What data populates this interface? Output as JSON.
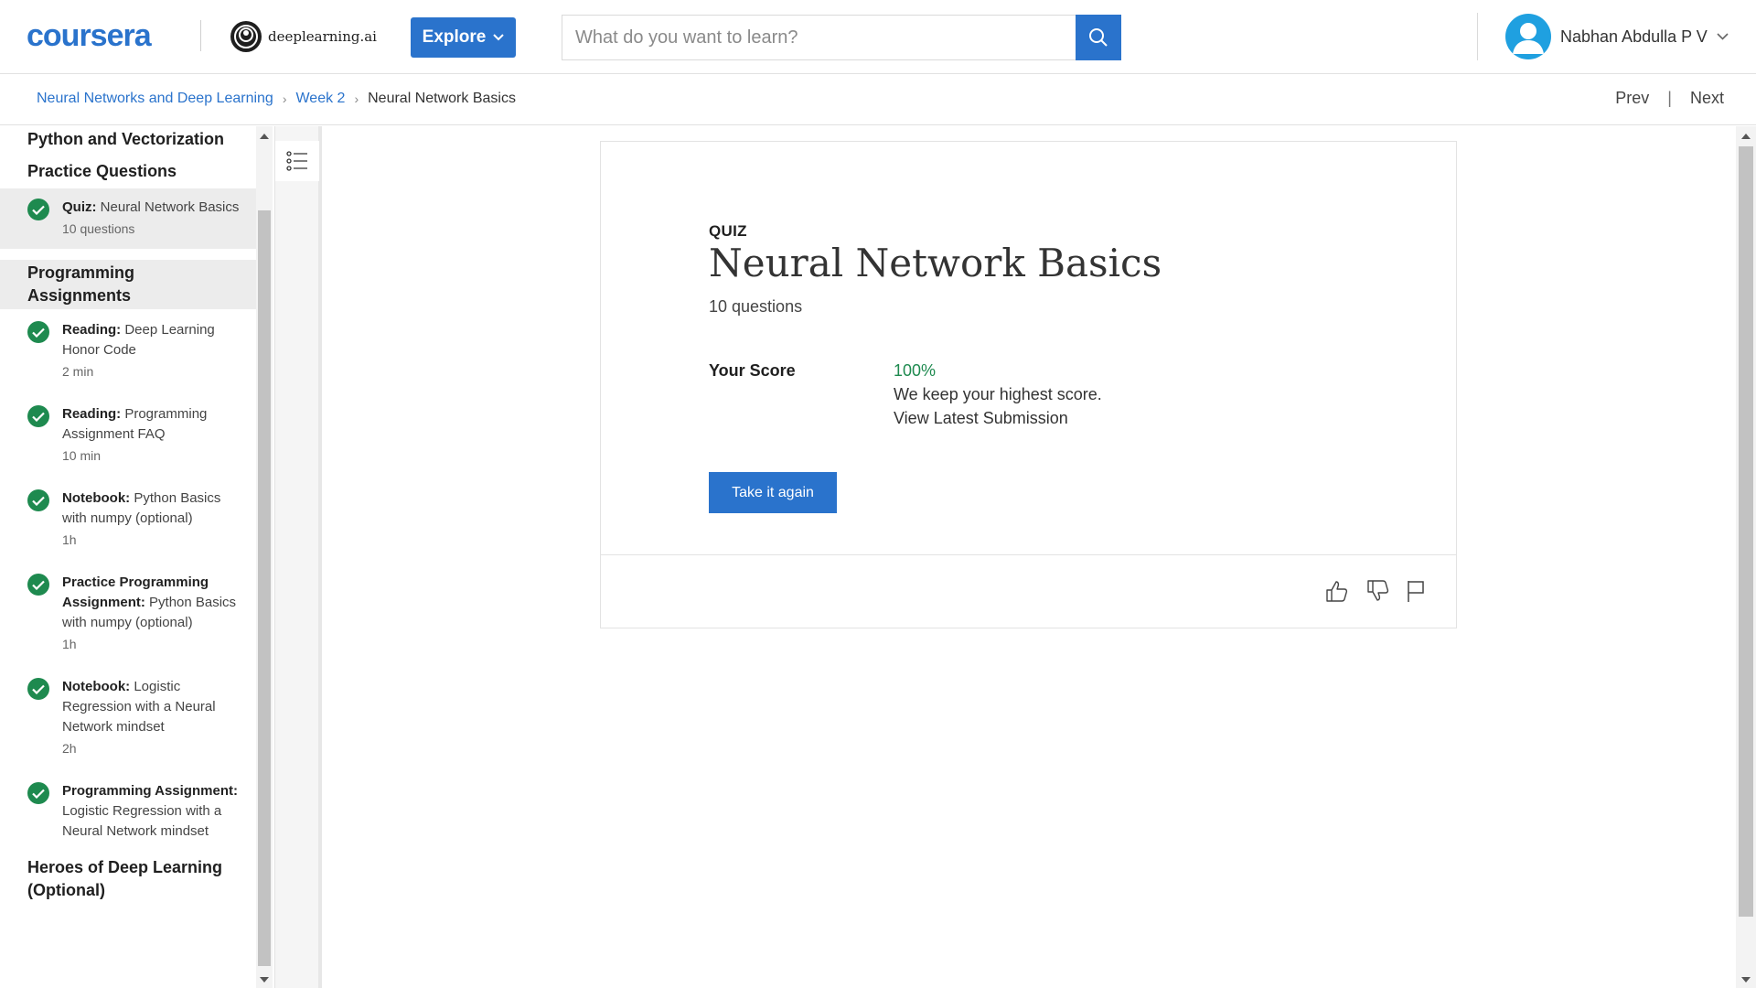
{
  "header": {
    "brand": "coursera",
    "partner": "deeplearning.ai",
    "explore_label": "Explore",
    "search_placeholder": "What do you want to learn?",
    "user_name": "Nabhan Abdulla P V"
  },
  "breadcrumb": {
    "items": [
      "Neural Networks and Deep Learning",
      "Week 2",
      "Neural Network Basics"
    ],
    "prev": "Prev",
    "next": "Next"
  },
  "sidebar": {
    "sec_python": "Python and Vectorization",
    "sec_practice": "Practice Questions",
    "quiz_item": {
      "type": "Quiz:",
      "title": "Neural Network Basics",
      "meta": "10 questions"
    },
    "sec_programming": "Programming Assignments",
    "items": [
      {
        "type": "Reading:",
        "title": "Deep Learning Honor Code",
        "meta": "2 min"
      },
      {
        "type": "Reading:",
        "title": "Programming Assignment FAQ",
        "meta": "10 min"
      },
      {
        "type": "Notebook:",
        "title": "Python Basics with numpy (optional)",
        "meta": "1h"
      },
      {
        "type": "Practice Programming Assignment:",
        "title": "Python Basics with numpy (optional)",
        "meta": "1h"
      },
      {
        "type": "Notebook:",
        "title": "Logistic Regression with a Neural Network mindset",
        "meta": "2h"
      },
      {
        "type": "Programming Assignment:",
        "title": "Logistic Regression with a Neural Network mindset",
        "meta": ""
      }
    ],
    "sec_heroes": "Heroes of Deep Learning (Optional)"
  },
  "quiz": {
    "kicker": "QUIZ",
    "title": "Neural Network Basics",
    "count": "10 questions",
    "score_label": "Your Score",
    "score_value": "100%",
    "score_note": "We keep your highest score.",
    "view_link": "View Latest Submission",
    "retake_label": "Take it again"
  },
  "colors": {
    "brand_blue": "#2a73cc",
    "success_green": "#1e8a4f",
    "avatar_blue": "#1fa0e0"
  },
  "icons": [
    "search-icon",
    "chevron-down-icon",
    "avatar-icon",
    "check-icon",
    "outline-list-icon",
    "thumbs-up-icon",
    "thumbs-down-icon",
    "flag-icon"
  ]
}
